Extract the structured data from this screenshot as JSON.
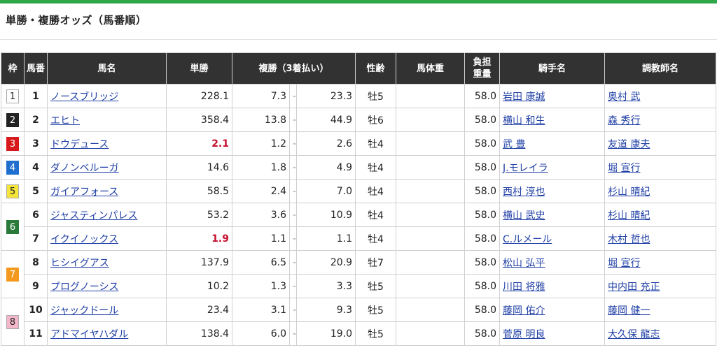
{
  "page": {
    "title": "単勝・複勝オッズ（馬番順）"
  },
  "colors": {
    "accent_bar": "#2fa84a",
    "header_bg": "#323232",
    "favorite_text": "#c8102e",
    "link": "#1f3fa6",
    "waku": {
      "1": "#ffffff",
      "2": "#222222",
      "3": "#d7191c",
      "4": "#1f6fd0",
      "5": "#f5e43a",
      "6": "#2a7a3a",
      "7": "#f39a1e",
      "8": "#f4b7c9"
    }
  },
  "table": {
    "headers": {
      "waku": "枠",
      "umaban": "馬番",
      "horse": "馬名",
      "win": "単勝",
      "place": "複勝（3着払い）",
      "sexage": "性齢",
      "weight": "馬体重",
      "burden1": "負担",
      "burden2": "重量",
      "jockey": "騎手名",
      "trainer": "調教師名"
    },
    "groups": [
      {
        "waku": "1",
        "rows": [
          {
            "num": "1",
            "horse": "ノースブリッジ",
            "win": "228.1",
            "fav": false,
            "pmin": "7.3",
            "pmax": "23.3",
            "sexage": "牡5",
            "weight": "",
            "burden": "58.0",
            "jockey": "岩田 康誠",
            "trainer": "奥村 武"
          }
        ]
      },
      {
        "waku": "2",
        "rows": [
          {
            "num": "2",
            "horse": "エヒト",
            "win": "358.4",
            "fav": false,
            "pmin": "13.8",
            "pmax": "44.9",
            "sexage": "牡6",
            "weight": "",
            "burden": "58.0",
            "jockey": "横山 和生",
            "trainer": "森 秀行"
          }
        ]
      },
      {
        "waku": "3",
        "rows": [
          {
            "num": "3",
            "horse": "ドウデュース",
            "win": "2.1",
            "fav": true,
            "pmin": "1.2",
            "pmax": "2.6",
            "sexage": "牡4",
            "weight": "",
            "burden": "58.0",
            "jockey": "武 豊",
            "trainer": "友道 康夫"
          }
        ]
      },
      {
        "waku": "4",
        "rows": [
          {
            "num": "4",
            "horse": "ダノンベルーガ",
            "win": "14.6",
            "fav": false,
            "pmin": "1.8",
            "pmax": "4.9",
            "sexage": "牡4",
            "weight": "",
            "burden": "58.0",
            "jockey": "J.モレイラ",
            "trainer": "堀 宣行"
          }
        ]
      },
      {
        "waku": "5",
        "rows": [
          {
            "num": "5",
            "horse": "ガイアフォース",
            "win": "58.5",
            "fav": false,
            "pmin": "2.4",
            "pmax": "7.0",
            "sexage": "牡4",
            "weight": "",
            "burden": "58.0",
            "jockey": "西村 淳也",
            "trainer": "杉山 晴紀"
          }
        ]
      },
      {
        "waku": "6",
        "rows": [
          {
            "num": "6",
            "horse": "ジャスティンパレス",
            "win": "53.2",
            "fav": false,
            "pmin": "3.6",
            "pmax": "10.9",
            "sexage": "牡4",
            "weight": "",
            "burden": "58.0",
            "jockey": "横山 武史",
            "trainer": "杉山 晴紀"
          },
          {
            "num": "7",
            "horse": "イクイノックス",
            "win": "1.9",
            "fav": true,
            "pmin": "1.1",
            "pmax": "1.1",
            "sexage": "牡4",
            "weight": "",
            "burden": "58.0",
            "jockey": "C.ルメール",
            "trainer": "木村 哲也"
          }
        ]
      },
      {
        "waku": "7",
        "rows": [
          {
            "num": "8",
            "horse": "ヒシイグアス",
            "win": "137.9",
            "fav": false,
            "pmin": "6.5",
            "pmax": "20.9",
            "sexage": "牡7",
            "weight": "",
            "burden": "58.0",
            "jockey": "松山 弘平",
            "trainer": "堀 宣行"
          },
          {
            "num": "9",
            "horse": "プログノーシス",
            "win": "10.2",
            "fav": false,
            "pmin": "1.3",
            "pmax": "3.3",
            "sexage": "牡5",
            "weight": "",
            "burden": "58.0",
            "jockey": "川田 将雅",
            "trainer": "中内田 充正"
          }
        ]
      },
      {
        "waku": "8",
        "rows": [
          {
            "num": "10",
            "horse": "ジャックドール",
            "win": "23.4",
            "fav": false,
            "pmin": "3.1",
            "pmax": "9.3",
            "sexage": "牡5",
            "weight": "",
            "burden": "58.0",
            "jockey": "藤岡 佑介",
            "trainer": "藤岡 健一"
          },
          {
            "num": "11",
            "horse": "アドマイヤハダル",
            "win": "138.4",
            "fav": false,
            "pmin": "6.0",
            "pmax": "19.0",
            "sexage": "牡5",
            "weight": "",
            "burden": "58.0",
            "jockey": "菅原 明良",
            "trainer": "大久保 龍志"
          }
        ]
      }
    ],
    "dash": "-"
  }
}
